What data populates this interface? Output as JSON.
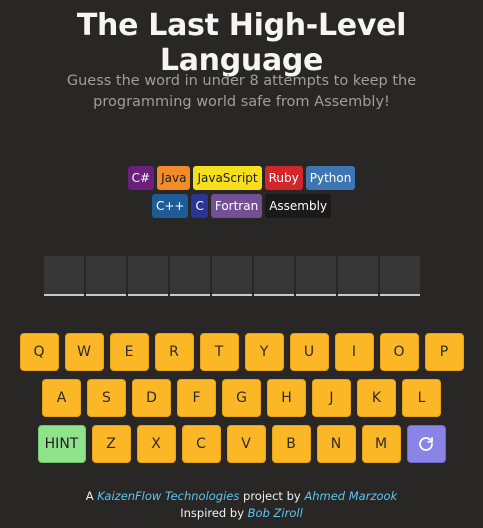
{
  "header": {
    "title": "The Last High-Level Language",
    "subtitle": "Guess the word in under 8 attempts to keep the programming world safe from Assembly!"
  },
  "languages": {
    "row1": [
      {
        "label": "C#",
        "bg": "#6a1f7c",
        "fg": "#ffffff"
      },
      {
        "label": "Java",
        "bg": "#f28c28",
        "fg": "#1e1e1e"
      },
      {
        "label": "JavaScript",
        "bg": "#f7df1e",
        "fg": "#1e1e1e"
      },
      {
        "label": "Ruby",
        "bg": "#d1262c",
        "fg": "#ffffff"
      },
      {
        "label": "Python",
        "bg": "#3d76b3",
        "fg": "#ffffff"
      }
    ],
    "row2": [
      {
        "label": "C++",
        "bg": "#1d5c97",
        "fg": "#ffffff"
      },
      {
        "label": "C",
        "bg": "#283593",
        "fg": "#ffffff"
      },
      {
        "label": "Fortran",
        "bg": "#734f96",
        "fg": "#ffffff"
      },
      {
        "label": "Assembly",
        "bg": "#1a1a1a",
        "fg": "#ffffff"
      }
    ]
  },
  "board": {
    "slot_count": 9
  },
  "keyboard": {
    "row1": [
      "Q",
      "W",
      "E",
      "R",
      "T",
      "Y",
      "U",
      "I",
      "O",
      "P"
    ],
    "row2": [
      "A",
      "S",
      "D",
      "F",
      "G",
      "H",
      "J",
      "K",
      "L"
    ],
    "row3": [
      "Z",
      "X",
      "C",
      "V",
      "B",
      "N",
      "M"
    ],
    "hint_label": "HINT",
    "reset_icon": "refresh-icon"
  },
  "footer": {
    "line1_prefix": "A ",
    "company": "KaizenFlow Technologies",
    "line1_mid": " project by ",
    "author": "Ahmed Marzook",
    "line2_prefix": "Inspired by ",
    "inspiration": "Bob Ziroll"
  },
  "colors": {
    "background": "#282726",
    "key": "#fbb726",
    "hint": "#8fe38b",
    "reset": "#8a84e6",
    "link": "#5cc6f2"
  }
}
